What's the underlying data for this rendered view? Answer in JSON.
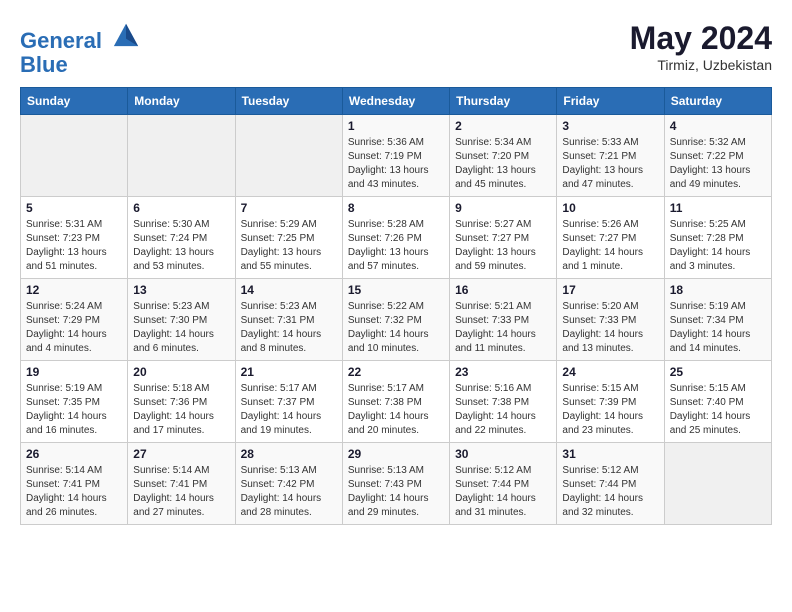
{
  "header": {
    "logo_line1": "General",
    "logo_line2": "Blue",
    "month": "May 2024",
    "location": "Tirmiz, Uzbekistan"
  },
  "weekdays": [
    "Sunday",
    "Monday",
    "Tuesday",
    "Wednesday",
    "Thursday",
    "Friday",
    "Saturday"
  ],
  "weeks": [
    [
      {
        "day": "",
        "empty": true
      },
      {
        "day": "",
        "empty": true
      },
      {
        "day": "",
        "empty": true
      },
      {
        "day": "1",
        "sunrise": "5:36 AM",
        "sunset": "7:19 PM",
        "daylight": "13 hours and 43 minutes."
      },
      {
        "day": "2",
        "sunrise": "5:34 AM",
        "sunset": "7:20 PM",
        "daylight": "13 hours and 45 minutes."
      },
      {
        "day": "3",
        "sunrise": "5:33 AM",
        "sunset": "7:21 PM",
        "daylight": "13 hours and 47 minutes."
      },
      {
        "day": "4",
        "sunrise": "5:32 AM",
        "sunset": "7:22 PM",
        "daylight": "13 hours and 49 minutes."
      }
    ],
    [
      {
        "day": "5",
        "sunrise": "5:31 AM",
        "sunset": "7:23 PM",
        "daylight": "13 hours and 51 minutes."
      },
      {
        "day": "6",
        "sunrise": "5:30 AM",
        "sunset": "7:24 PM",
        "daylight": "13 hours and 53 minutes."
      },
      {
        "day": "7",
        "sunrise": "5:29 AM",
        "sunset": "7:25 PM",
        "daylight": "13 hours and 55 minutes."
      },
      {
        "day": "8",
        "sunrise": "5:28 AM",
        "sunset": "7:26 PM",
        "daylight": "13 hours and 57 minutes."
      },
      {
        "day": "9",
        "sunrise": "5:27 AM",
        "sunset": "7:27 PM",
        "daylight": "13 hours and 59 minutes."
      },
      {
        "day": "10",
        "sunrise": "5:26 AM",
        "sunset": "7:27 PM",
        "daylight": "14 hours and 1 minute."
      },
      {
        "day": "11",
        "sunrise": "5:25 AM",
        "sunset": "7:28 PM",
        "daylight": "14 hours and 3 minutes."
      }
    ],
    [
      {
        "day": "12",
        "sunrise": "5:24 AM",
        "sunset": "7:29 PM",
        "daylight": "14 hours and 4 minutes."
      },
      {
        "day": "13",
        "sunrise": "5:23 AM",
        "sunset": "7:30 PM",
        "daylight": "14 hours and 6 minutes."
      },
      {
        "day": "14",
        "sunrise": "5:23 AM",
        "sunset": "7:31 PM",
        "daylight": "14 hours and 8 minutes."
      },
      {
        "day": "15",
        "sunrise": "5:22 AM",
        "sunset": "7:32 PM",
        "daylight": "14 hours and 10 minutes."
      },
      {
        "day": "16",
        "sunrise": "5:21 AM",
        "sunset": "7:33 PM",
        "daylight": "14 hours and 11 minutes."
      },
      {
        "day": "17",
        "sunrise": "5:20 AM",
        "sunset": "7:33 PM",
        "daylight": "14 hours and 13 minutes."
      },
      {
        "day": "18",
        "sunrise": "5:19 AM",
        "sunset": "7:34 PM",
        "daylight": "14 hours and 14 minutes."
      }
    ],
    [
      {
        "day": "19",
        "sunrise": "5:19 AM",
        "sunset": "7:35 PM",
        "daylight": "14 hours and 16 minutes."
      },
      {
        "day": "20",
        "sunrise": "5:18 AM",
        "sunset": "7:36 PM",
        "daylight": "14 hours and 17 minutes."
      },
      {
        "day": "21",
        "sunrise": "5:17 AM",
        "sunset": "7:37 PM",
        "daylight": "14 hours and 19 minutes."
      },
      {
        "day": "22",
        "sunrise": "5:17 AM",
        "sunset": "7:38 PM",
        "daylight": "14 hours and 20 minutes."
      },
      {
        "day": "23",
        "sunrise": "5:16 AM",
        "sunset": "7:38 PM",
        "daylight": "14 hours and 22 minutes."
      },
      {
        "day": "24",
        "sunrise": "5:15 AM",
        "sunset": "7:39 PM",
        "daylight": "14 hours and 23 minutes."
      },
      {
        "day": "25",
        "sunrise": "5:15 AM",
        "sunset": "7:40 PM",
        "daylight": "14 hours and 25 minutes."
      }
    ],
    [
      {
        "day": "26",
        "sunrise": "5:14 AM",
        "sunset": "7:41 PM",
        "daylight": "14 hours and 26 minutes."
      },
      {
        "day": "27",
        "sunrise": "5:14 AM",
        "sunset": "7:41 PM",
        "daylight": "14 hours and 27 minutes."
      },
      {
        "day": "28",
        "sunrise": "5:13 AM",
        "sunset": "7:42 PM",
        "daylight": "14 hours and 28 minutes."
      },
      {
        "day": "29",
        "sunrise": "5:13 AM",
        "sunset": "7:43 PM",
        "daylight": "14 hours and 29 minutes."
      },
      {
        "day": "30",
        "sunrise": "5:12 AM",
        "sunset": "7:44 PM",
        "daylight": "14 hours and 31 minutes."
      },
      {
        "day": "31",
        "sunrise": "5:12 AM",
        "sunset": "7:44 PM",
        "daylight": "14 hours and 32 minutes."
      },
      {
        "day": "",
        "empty": true
      }
    ]
  ]
}
